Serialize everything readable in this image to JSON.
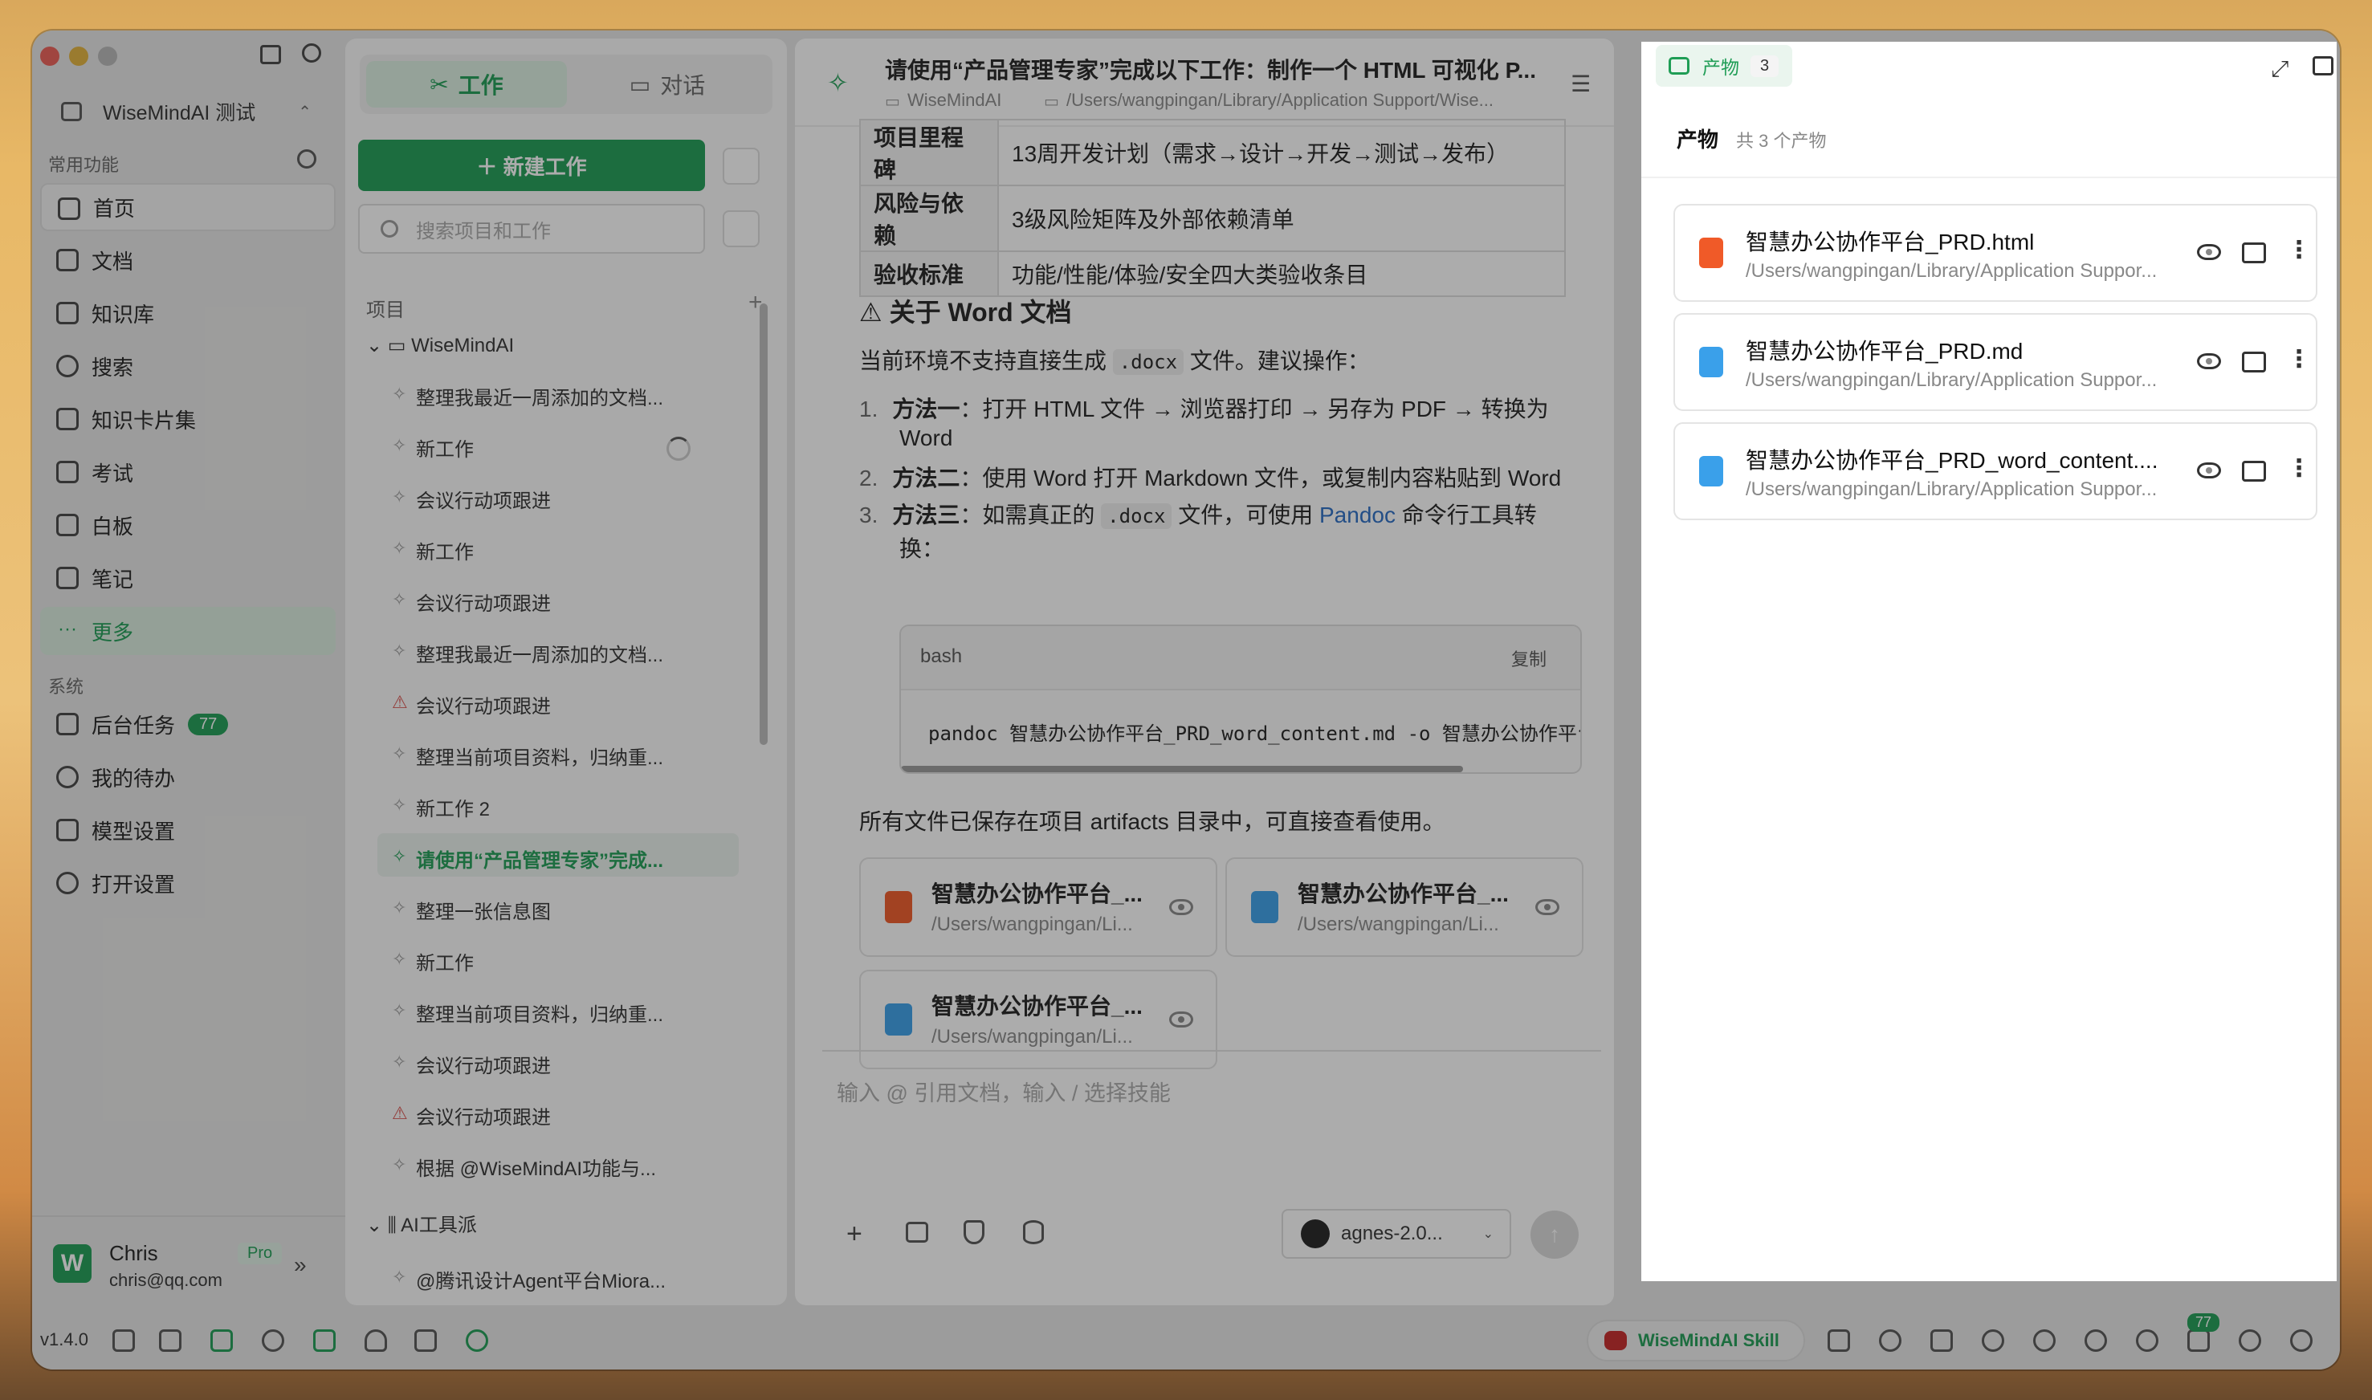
{
  "sidebar": {
    "workspace": "WiseMindAI 测试",
    "common_label": "常用功能",
    "nav": [
      "首页",
      "文档",
      "知识库",
      "搜索",
      "知识卡片集",
      "考试",
      "白板",
      "笔记",
      "更多"
    ],
    "system_label": "系统",
    "system": [
      {
        "label": "后台任务",
        "badge": "77"
      },
      {
        "label": "我的待办"
      },
      {
        "label": "模型设置"
      },
      {
        "label": "打开设置"
      }
    ],
    "user": {
      "name": "Chris",
      "plan": "Pro",
      "email": "chris@qq.com",
      "avatar": "W"
    }
  },
  "projects": {
    "tab_work": "工作",
    "tab_chat": "对话",
    "new_button": "＋ 新建工作",
    "search_placeholder": "搜索项目和工作",
    "section_label": "项目",
    "group1": "WiseMindAI",
    "items": [
      "整理我最近一周添加的文档...",
      "新工作",
      "会议行动项跟进",
      "新工作",
      "会议行动项跟进",
      "整理我最近一周添加的文档...",
      "会议行动项跟进",
      "整理当前项目资料，归纳重...",
      "新工作 2",
      "请使用“产品管理专家”完成...",
      "整理一张信息图",
      "新工作",
      "整理当前项目资料，归纳重...",
      "会议行动项跟进",
      "会议行动项跟进",
      "根据 @WiseMindAI功能与..."
    ],
    "group2": "AI工具派",
    "group2_item": "@腾讯设计Agent平台Miora..."
  },
  "chat": {
    "title": "请使用“产品管理专家”完成以下工作：制作一个 HTML 可视化 P...",
    "path_project": "WiseMindAI",
    "path": "/Users/wangpingan/Library/Application Support/Wise...",
    "table": [
      {
        "k": "项目里程碑",
        "v": "13周开发计划（需求→设计→开发→测试→发布）"
      },
      {
        "k": "风险与依赖",
        "v": "3级风险矩阵及外部依赖清单"
      },
      {
        "k": "验收标准",
        "v": "功能/性能/体验/安全四大类验收条目"
      }
    ],
    "word_heading": "⚠ 关于 Word 文档",
    "word_intro_a": "当前环境不支持直接生成",
    "word_intro_code": ".docx",
    "word_intro_b": "文件。建议操作：",
    "m1_label": "方法一",
    "m1_text": "：打开 HTML 文件 → 浏览器打印 → 另存为 PDF → 转换为",
    "m1_text2": "Word",
    "m2_label": "方法二",
    "m2_text": "：使用 Word 打开 Markdown 文件，或复制内容粘贴到 Word",
    "m3_label": "方法三",
    "m3_text_a": "：如需真正的",
    "m3_code": ".docx",
    "m3_text_b": "文件，可使用",
    "m3_link": "Pandoc",
    "m3_text_c": "命令行工具转",
    "m3_text2": "换：",
    "code_lang": "bash",
    "code_copy": "复制",
    "code": "pandoc 智慧办公协作平台_PRD_word_content.md -o 智慧办公协作平台",
    "saved_note": "所有文件已保存在项目 artifacts 目录中，可直接查看使用。",
    "files": [
      {
        "title": "智慧办公协作平台_...",
        "path": "/Users/wangpingan/Li..."
      },
      {
        "title": "智慧办公协作平台_...",
        "path": "/Users/wangpingan/Li..."
      },
      {
        "title": "智慧办公协作平台_...",
        "path": "/Users/wangpingan/Li..."
      }
    ],
    "input_placeholder": "输入 @ 引用文档，输入 / 选择技能",
    "model": "agnes-2.0..."
  },
  "artifacts": {
    "tab_label": "产物",
    "tab_count": "3",
    "heading": "产物",
    "heading_count": "共 3 个产物",
    "items": [
      {
        "name": "智慧办公协作平台_PRD.html",
        "path": "/Users/wangpingan/Library/Application Suppor...",
        "type": "html"
      },
      {
        "name": "智慧办公协作平台_PRD.md",
        "path": "/Users/wangpingan/Library/Application Suppor...",
        "type": "md"
      },
      {
        "name": "智慧办公协作平台_PRD_word_content....",
        "path": "/Users/wangpingan/Library/Application Suppor...",
        "type": "md"
      }
    ]
  },
  "bottombar": {
    "version": "v1.4.0",
    "skill": "WiseMindAI Skill",
    "badge": "77"
  },
  "colors": {
    "accent": "#1f9d55",
    "html_icon": "#f05a28",
    "md_icon": "#3aa0ea"
  }
}
